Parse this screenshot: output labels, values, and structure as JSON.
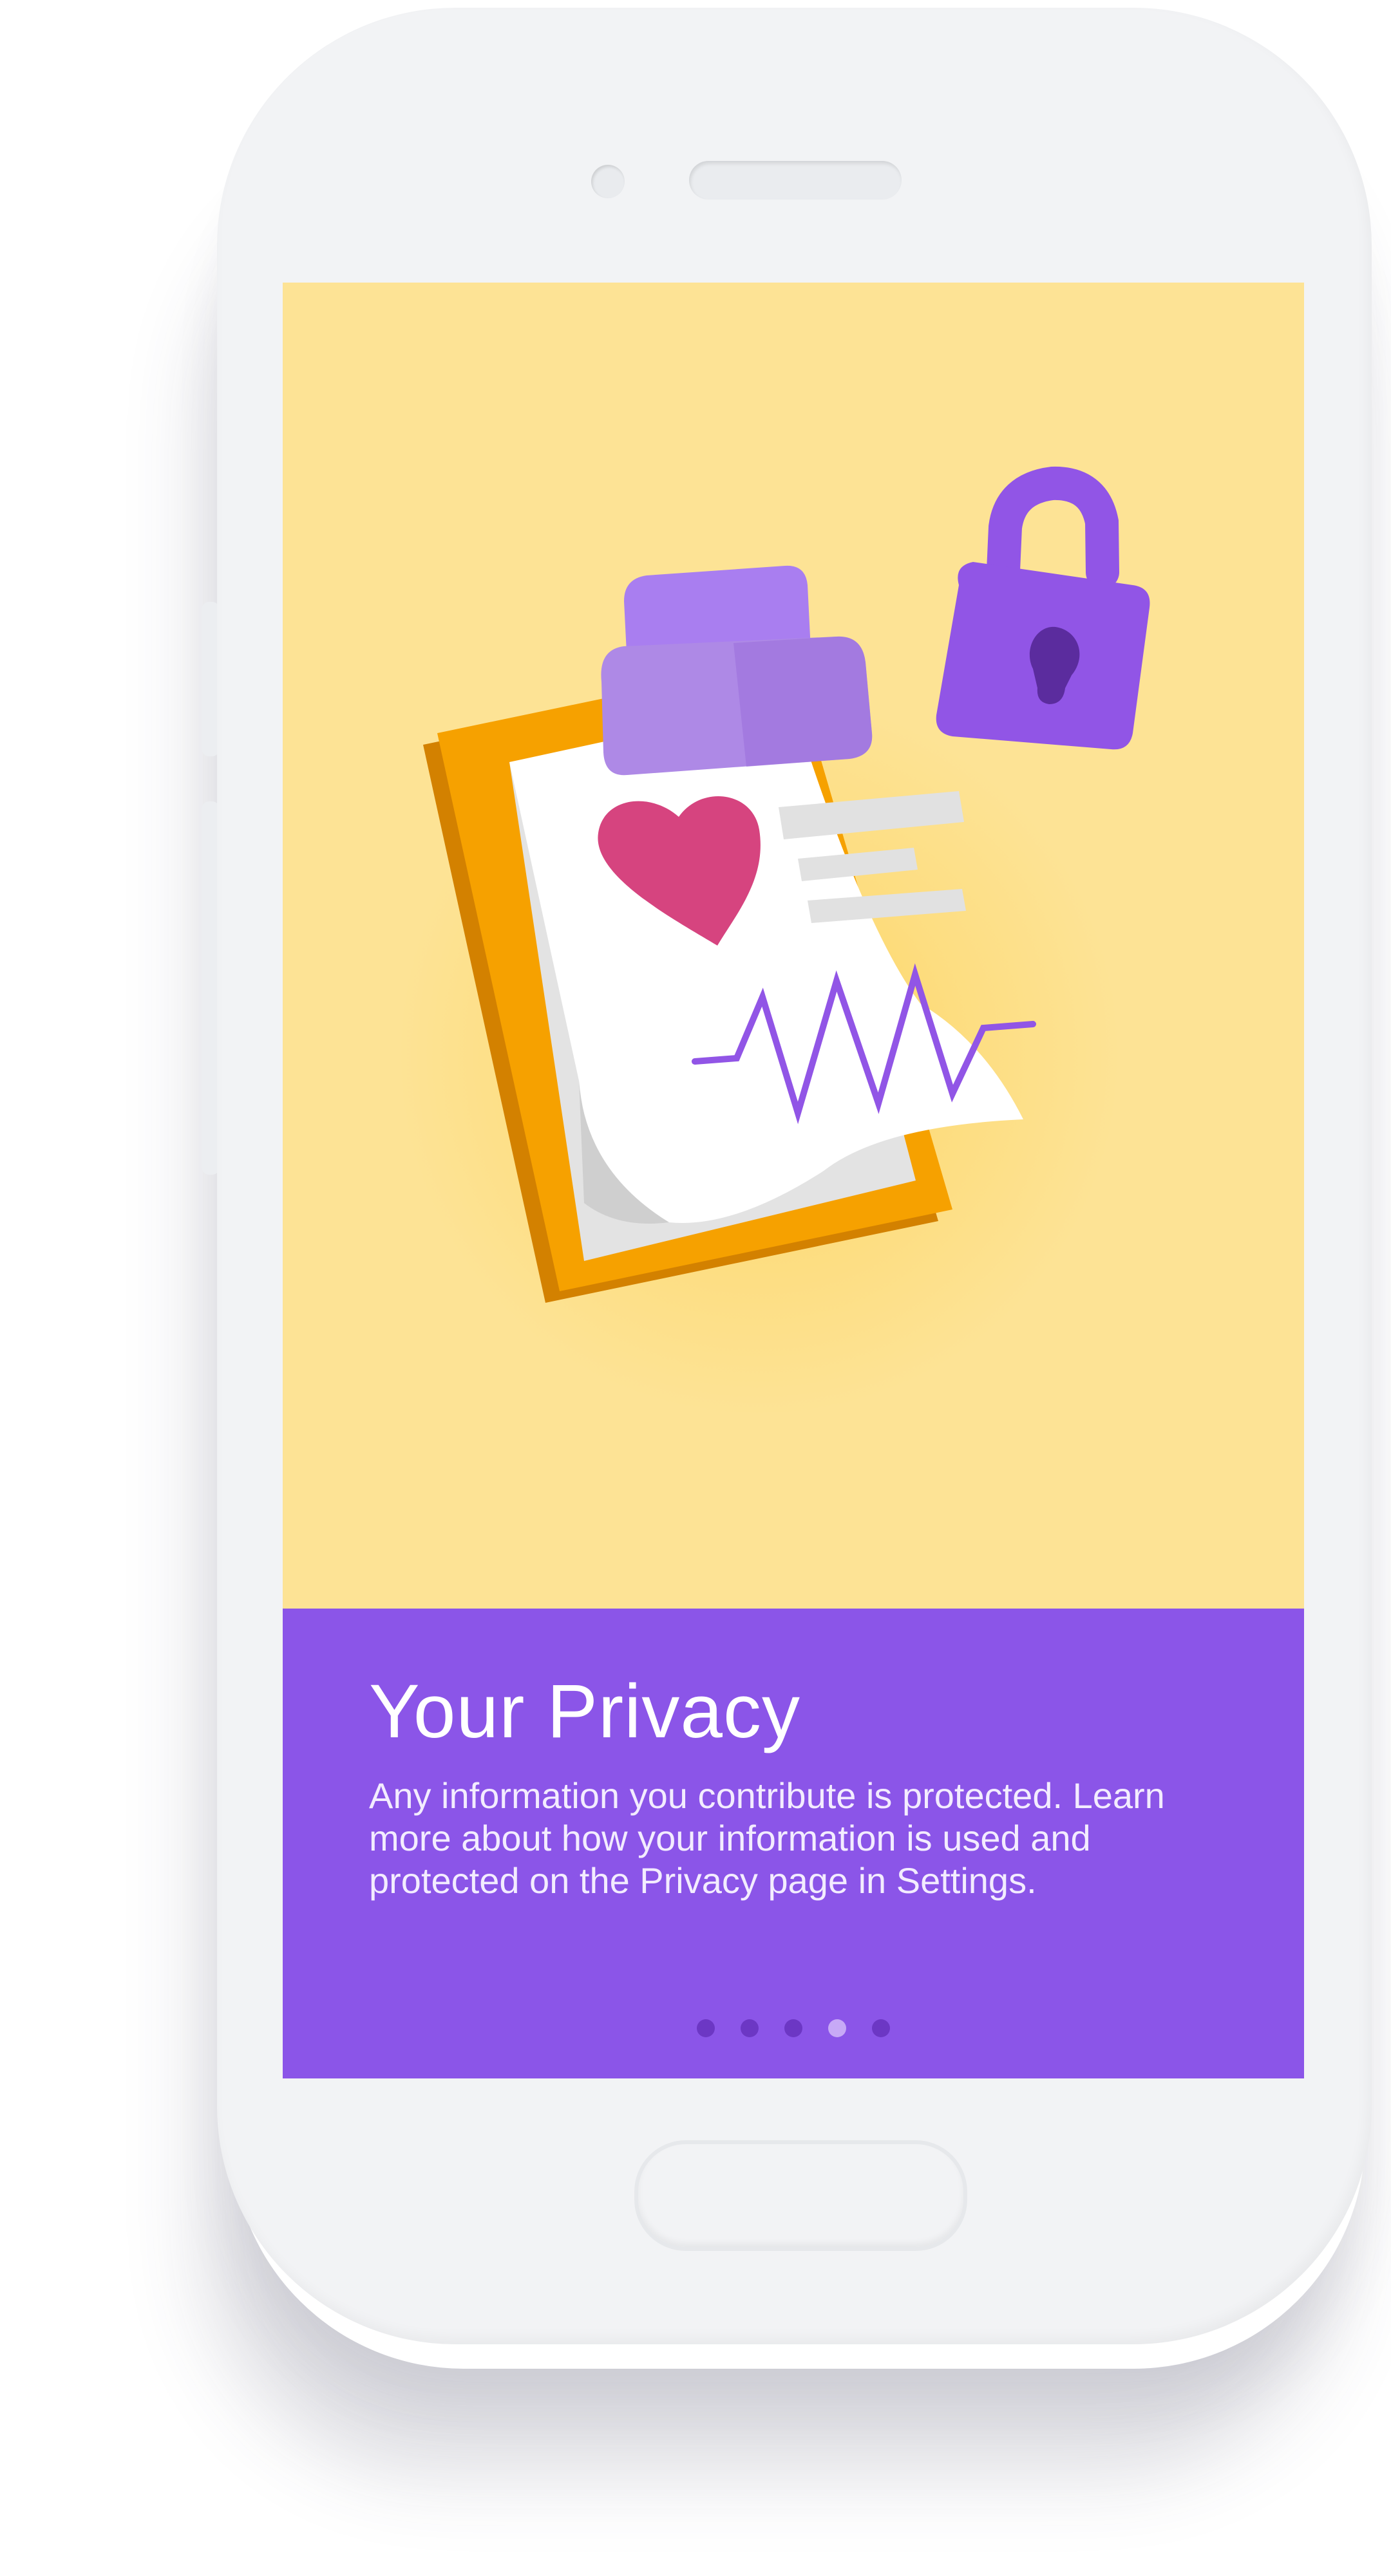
{
  "onboarding": {
    "title": "Your Privacy",
    "body": "Any information you contribute is protected. Learn more about how your information is used and protected on the Privacy page in Settings.",
    "pager": {
      "total_pages": 5,
      "current_page": 4
    }
  },
  "illustration": {
    "icons": [
      "clipboard-icon",
      "heart-icon",
      "heartbeat-line-icon",
      "padlock-icon"
    ]
  },
  "colors": {
    "hero_background": "#fde395",
    "info_background": "#8b55e8",
    "accent_purple": "#9155e6",
    "clipboard_orange": "#f6a100",
    "heart_pink": "#d6447f",
    "dot_inactive": "#6c37c4",
    "dot_active": "#c7a9f6",
    "device_body": "#f2f3f5"
  }
}
